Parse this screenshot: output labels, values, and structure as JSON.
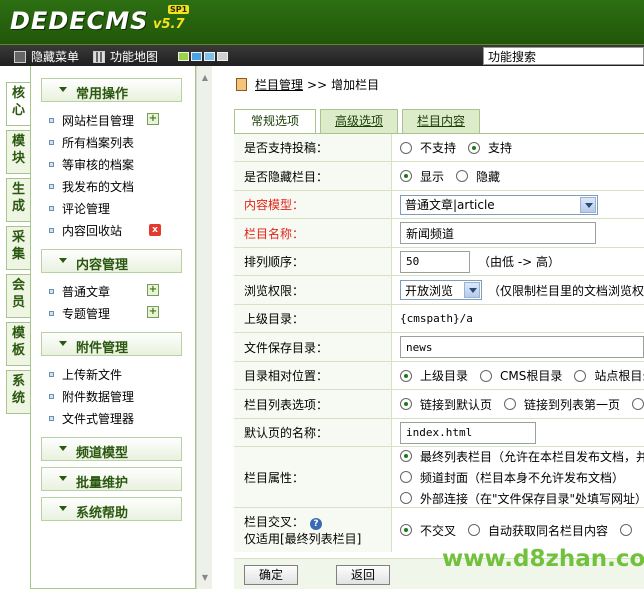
{
  "header": {
    "logo": "DEDECMS",
    "version": "v5.7",
    "sp": "SP1"
  },
  "toolbar": {
    "hide_menu": "隐藏菜单",
    "site_map": "功能地图",
    "search_value": "功能搜索",
    "colors": [
      "#9bd347",
      "#4aa2e6",
      "#7fc0e9",
      "#cfcfcf"
    ]
  },
  "sidetabs": [
    "核心",
    "模块",
    "生成",
    "采集",
    "会员",
    "模板",
    "系统"
  ],
  "menu": {
    "group_common": "常用操作",
    "common_items": [
      "网站栏目管理",
      "所有档案列表",
      "等审核的档案",
      "我发布的文档",
      "评论管理",
      "内容回收站"
    ],
    "group_content": "内容管理",
    "content_items": [
      "普通文章",
      "专题管理"
    ],
    "group_attach": "附件管理",
    "attach_items": [
      "上传新文件",
      "附件数据管理",
      "文件式管理器"
    ],
    "group_channel": "频道模型",
    "group_batch": "批量维护",
    "group_help": "系统帮助"
  },
  "breadcrumb": {
    "link": "栏目管理",
    "sep": ">>",
    "current": "增加栏目"
  },
  "tabs": [
    "常规选项",
    "高级选项",
    "栏目内容"
  ],
  "form": {
    "submit_label": "是否支持投稿：",
    "submit_opts": [
      "不支持",
      "支持"
    ],
    "hidden_label": "是否隐藏栏目：",
    "hidden_opts": [
      "显示",
      "隐藏"
    ],
    "model_label": "内容模型：",
    "model_value": "普通文章|article",
    "name_label": "栏目名称：",
    "name_value": "新闻频道",
    "order_label": "排列顺序：",
    "order_value": "50",
    "order_hint": "（由低 -> 高）",
    "perm_label": "浏览权限：",
    "perm_value": "开放浏览",
    "perm_hint": "（仅限制栏目里的文档浏览权",
    "parent_label": "上级目录：",
    "parent_value": "{cmspath}/a",
    "savedir_label": "文件保存目录：",
    "savedir_value": "news",
    "relpos_label": "目录相对位置：",
    "relpos_opts": [
      "上级目录",
      "CMS根目录",
      "站点根目录"
    ],
    "listopt_label": "栏目列表选项：",
    "listopt_opts": [
      "链接到默认页",
      "链接到列表第一页"
    ],
    "defpage_label": "默认页的名称：",
    "defpage_value": "index.html",
    "attr_label": "栏目属性：",
    "attr_opts": [
      "最终列表栏目（允许在本栏目发布文档，并",
      "频道封面（栏目本身不允许发布文档）",
      "外部连接（在\"文件保存目录\"处填写网址）"
    ],
    "cross_label": "栏目交叉：",
    "cross_help": "?",
    "cross_sub": "仅适用[最终列表栏目]",
    "cross_opts": [
      "不交叉",
      "自动获取同名栏目内容"
    ]
  },
  "actions": {
    "ok": "确定",
    "back": "返回"
  },
  "watermark": "www.d8zhan.com"
}
